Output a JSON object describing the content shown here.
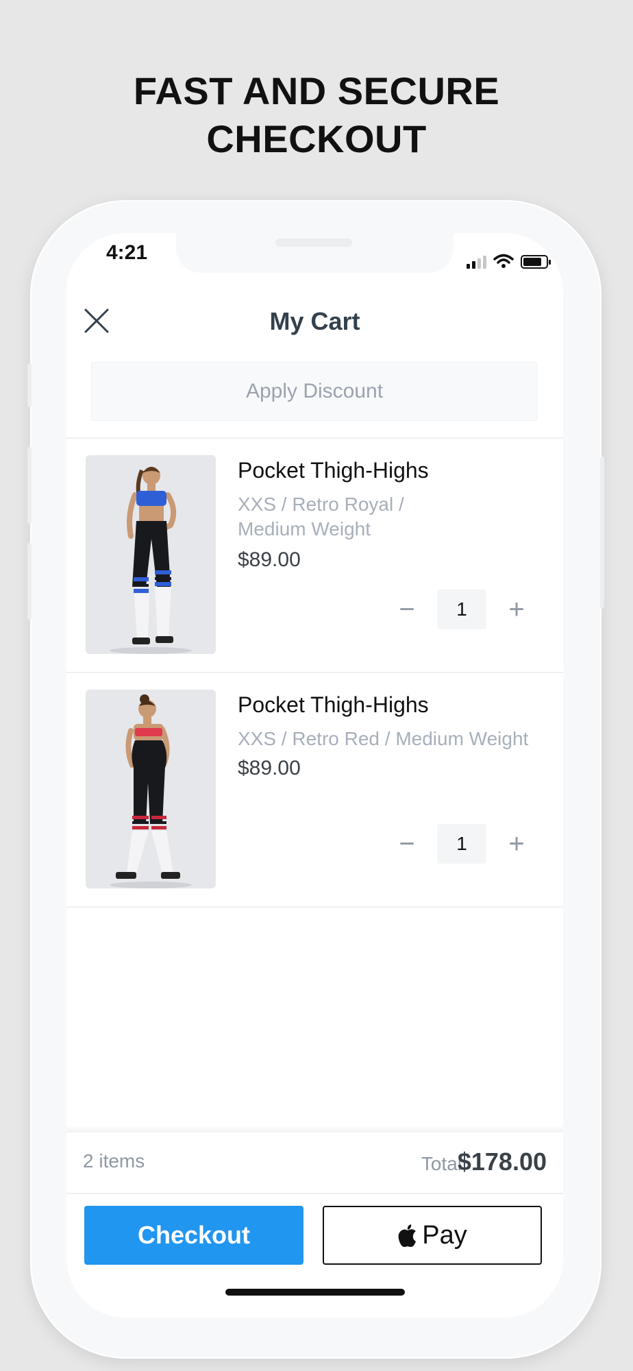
{
  "headline": {
    "line1": "FAST AND SECURE",
    "line2": "CHECKOUT"
  },
  "status_bar": {
    "time": "4:21"
  },
  "header": {
    "title": "My Cart"
  },
  "discount": {
    "label": "Apply Discount"
  },
  "items": [
    {
      "name": "Pocket Thigh-Highs",
      "variant_line1": "XXS / Retro Royal /",
      "variant_line2": "Medium Weight",
      "price": "$89.00",
      "quantity": "1",
      "minus": "−",
      "plus": "+",
      "accent_top": "#2f5fd6",
      "accent_stripe": "#2f5fd6"
    },
    {
      "name": "Pocket Thigh-Highs",
      "variant_line1": "XXS / Retro Red / Medium Weight",
      "variant_line2": "",
      "price": "$89.00",
      "quantity": "1",
      "minus": "−",
      "plus": "+",
      "accent_top": "#e03a4e",
      "accent_stripe": "#c8283a"
    }
  ],
  "summary": {
    "item_count": "2 items",
    "total_label": "Total",
    "total_value": "$178.00"
  },
  "actions": {
    "checkout_label": "Checkout",
    "applepay_label": "Pay"
  },
  "colors": {
    "accent": "#2196f0",
    "text_dark": "#3b4148",
    "text_muted": "#a7afba"
  }
}
